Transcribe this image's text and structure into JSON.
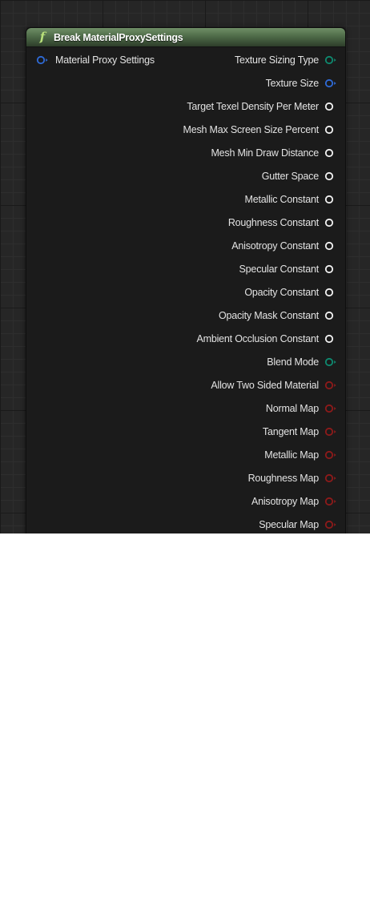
{
  "node": {
    "title": "Break MaterialProxySettings",
    "icon": "function-icon",
    "colors": {
      "header": "#4e6b48",
      "pin_struct": "#2f6bd8",
      "pin_enum": "#0e8a70",
      "pin_float": "#f2f2f2",
      "pin_bool": "#8e1a1a"
    }
  },
  "input_pin": {
    "label": "Material Proxy Settings",
    "type": "struct"
  },
  "output_pins": [
    {
      "label": "Texture Sizing Type",
      "type": "enum"
    },
    {
      "label": "Texture Size",
      "type": "struct"
    },
    {
      "label": "Target Texel Density Per Meter",
      "type": "float"
    },
    {
      "label": "Mesh Max Screen Size Percent",
      "type": "float"
    },
    {
      "label": "Mesh Min Draw Distance",
      "type": "float"
    },
    {
      "label": "Gutter Space",
      "type": "float"
    },
    {
      "label": "Metallic Constant",
      "type": "float"
    },
    {
      "label": "Roughness Constant",
      "type": "float"
    },
    {
      "label": "Anisotropy Constant",
      "type": "float"
    },
    {
      "label": "Specular Constant",
      "type": "float"
    },
    {
      "label": "Opacity Constant",
      "type": "float"
    },
    {
      "label": "Opacity Mask Constant",
      "type": "float"
    },
    {
      "label": "Ambient Occlusion Constant",
      "type": "float"
    },
    {
      "label": "Blend Mode",
      "type": "enum"
    },
    {
      "label": "Allow Two Sided Material",
      "type": "bool"
    },
    {
      "label": "Normal Map",
      "type": "bool"
    },
    {
      "label": "Tangent Map",
      "type": "bool"
    },
    {
      "label": "Metallic Map",
      "type": "bool"
    },
    {
      "label": "Roughness Map",
      "type": "bool"
    },
    {
      "label": "Anisotropy Map",
      "type": "bool"
    },
    {
      "label": "Specular Map",
      "type": "bool"
    }
  ]
}
